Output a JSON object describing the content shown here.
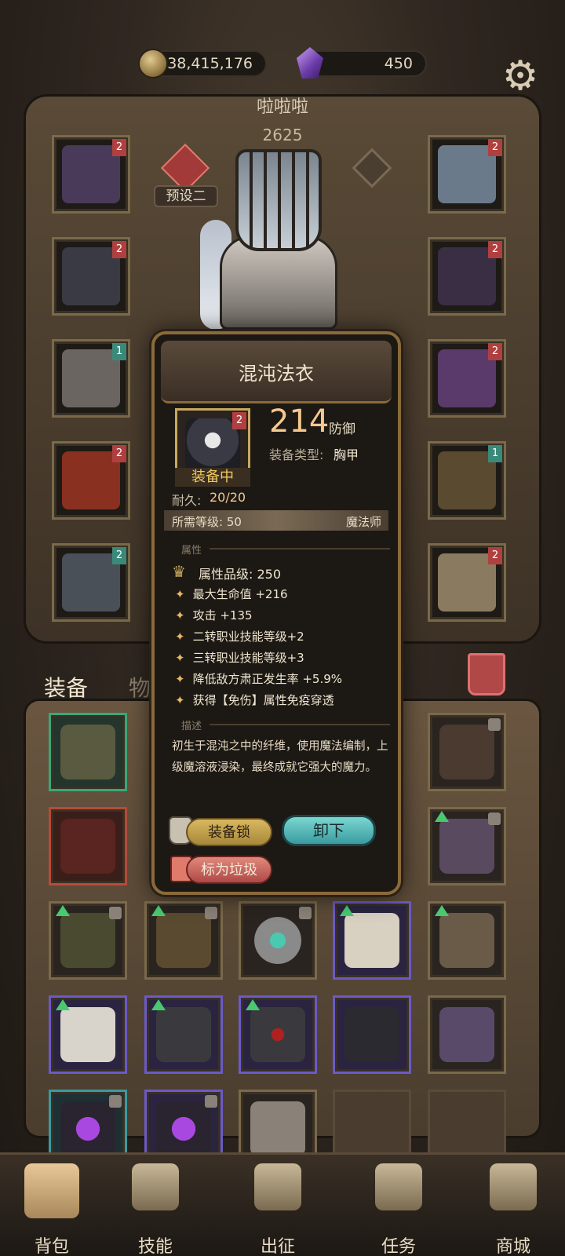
{
  "currency": {
    "gold": "38,415,176",
    "gems": "450"
  },
  "player": {
    "name": "啦啦啦",
    "power": "2625",
    "preset": "预设二"
  },
  "slots_left": [
    {
      "badge": "2",
      "color": "#4a3a5a"
    },
    {
      "badge": "2",
      "color": "#3a3a44"
    },
    {
      "badge": "1",
      "color": "#6a6560"
    },
    {
      "badge": "2",
      "color": "#8a3020"
    },
    {
      "badge": "2",
      "color": "#4a5058"
    }
  ],
  "slots_right": [
    {
      "badge": "2",
      "color": "#6a7a8a"
    },
    {
      "badge": "2",
      "color": "#3a2e44"
    },
    {
      "badge": "2",
      "color": "#5a3a6a"
    },
    {
      "badge": "1",
      "color": "#5a4a30"
    },
    {
      "badge": "2",
      "color": "#8a7a60"
    }
  ],
  "tabs": {
    "equip": "装备",
    "items": "物品"
  },
  "popup": {
    "title": "混沌法衣",
    "item_badge": "2",
    "equipped": "装备中",
    "defense_value": "214",
    "defense_label": "防御",
    "type_label": "装备类型:",
    "type_value": "胸甲",
    "durability_label": "耐久:",
    "durability_value": "20/20",
    "required_level": "所需等级: 50",
    "required_class": "魔法师",
    "attr_section": "属性",
    "grade": "属性品级: 250",
    "attributes": [
      "最大生命值 +216",
      "攻击 +135",
      "二转职业技能等级+2",
      "三转职业技能等级+3",
      "降低敌方肃正发生率 +5.9%",
      "获得【免伤】属性免疫穿透"
    ],
    "desc_section": "描述",
    "description": "初生于混沌之中的纤维，使用魔法编制，上级魔溶液浸染，最终成就它强大的魔力。",
    "btn_lock": "装备锁",
    "btn_unequip": "卸下",
    "btn_junk": "标为垃圾"
  },
  "nav": [
    {
      "label": "背包"
    },
    {
      "label": "技能"
    },
    {
      "label": "出征"
    },
    {
      "label": "任务"
    },
    {
      "label": "商城"
    }
  ]
}
